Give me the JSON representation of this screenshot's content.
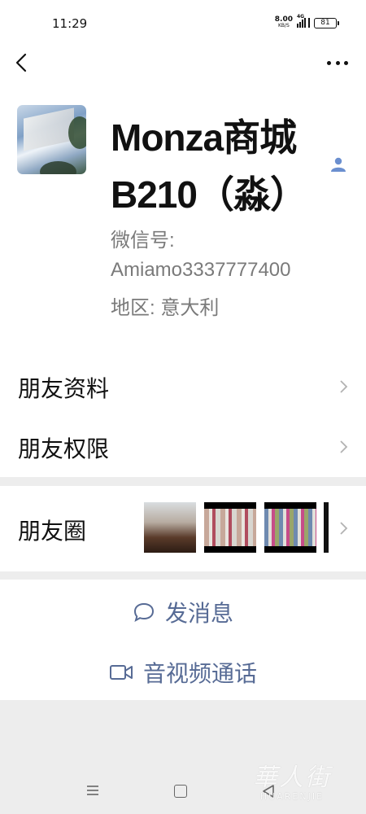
{
  "status_bar": {
    "time": "11:29",
    "net_speed": "8.00",
    "net_unit": "KB/S",
    "signal_label": "4G",
    "battery": "81"
  },
  "top_nav": {
    "back_icon": "chevron-left-icon",
    "more_icon": "more-dots-icon"
  },
  "profile": {
    "name": "Monza商城B210（淼）",
    "wechat_id_label": "微信号:",
    "wechat_id": "Amiamo3337777400",
    "region_label": "地区:",
    "region": "意大利",
    "contact_icon": "contact-person-icon"
  },
  "menu": {
    "friend_info": "朋友资料",
    "friend_permissions": "朋友权限",
    "moments": "朋友圈"
  },
  "actions": {
    "send_message": "发消息",
    "av_call": "音视频通话"
  },
  "watermark": {
    "cn": "華人街",
    "en": "HUARENJIE"
  },
  "colors": {
    "link_blue": "#576b95",
    "background": "#ededed",
    "secondary_text": "#7a7a7a"
  }
}
